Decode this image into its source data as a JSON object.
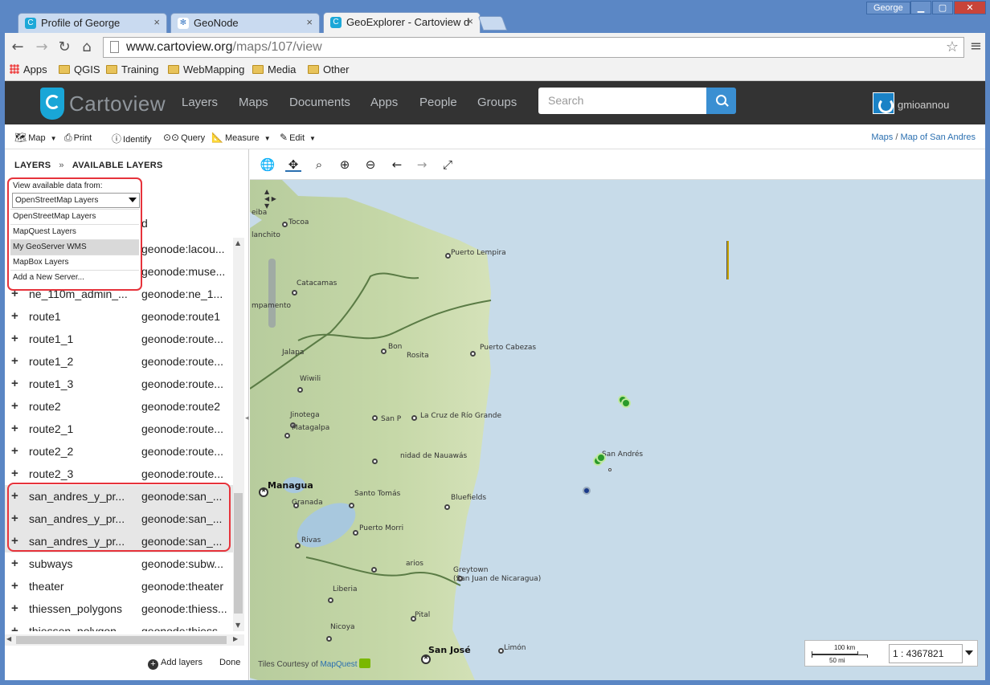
{
  "browser": {
    "tabs": [
      {
        "label": "Profile of George",
        "favicon": "cartoview-icon"
      },
      {
        "label": "GeoNode",
        "favicon": "geonode-icon"
      },
      {
        "label": "GeoExplorer - Cartoview d",
        "favicon": "cartoview-icon"
      }
    ],
    "user": "George",
    "url_host": "www.cartoview.org",
    "url_path": "/maps/107/view",
    "bookmarks": [
      "Apps",
      "QGIS",
      "Training",
      "WebMapping",
      "Media",
      "Other"
    ]
  },
  "navbar": {
    "brand": "Cartoview",
    "links": [
      "Layers",
      "Maps",
      "Documents",
      "Apps",
      "People",
      "Groups"
    ],
    "search_placeholder": "Search",
    "username": "gmioannou"
  },
  "toolbar": {
    "items": [
      "Map",
      "Print",
      "Identify",
      "Query",
      "Measure",
      "Edit"
    ],
    "breadcrumb": {
      "link1": "Maps",
      "sep": "/",
      "link2": "Map of San Andres"
    }
  },
  "panel": {
    "tab_layers": "LAYERS",
    "tab_sep": "»",
    "tab_available": "AVAILABLE LAYERS",
    "server_label": "View available data from:",
    "server_selected": "OpenStreetMap Layers",
    "server_options": [
      "OpenStreetMap Layers",
      "MapQuest Layers",
      "My GeoServer WMS",
      "MapBox Layers",
      "Add a New Server..."
    ],
    "header_fragment": "d",
    "layers": [
      {
        "name": "",
        "title": "geonode:lacou..."
      },
      {
        "name": "",
        "title": "geonode:muse..."
      },
      {
        "name": "ne_110m_admin_...",
        "title": "geonode:ne_1..."
      },
      {
        "name": "route1",
        "title": "geonode:route1"
      },
      {
        "name": "route1_1",
        "title": "geonode:route..."
      },
      {
        "name": "route1_2",
        "title": "geonode:route..."
      },
      {
        "name": "route1_3",
        "title": "geonode:route..."
      },
      {
        "name": "route2",
        "title": "geonode:route2"
      },
      {
        "name": "route2_1",
        "title": "geonode:route..."
      },
      {
        "name": "route2_2",
        "title": "geonode:route..."
      },
      {
        "name": "route2_3",
        "title": "geonode:route..."
      },
      {
        "name": "san_andres_y_pr...",
        "title": "geonode:san_..."
      },
      {
        "name": "san_andres_y_pr...",
        "title": "geonode:san_..."
      },
      {
        "name": "san_andres_y_pr...",
        "title": "geonode:san_..."
      },
      {
        "name": "subways",
        "title": "geonode:subw..."
      },
      {
        "name": "theater",
        "title": "geonode:theater"
      },
      {
        "name": "thiessen_polygons",
        "title": "geonode:thiess..."
      },
      {
        "name": "thiessen_polygon...",
        "title": "geonode:thiess..."
      }
    ],
    "add_layers": "Add layers",
    "done": "Done"
  },
  "map": {
    "places": [
      "Tocoa",
      "Puerto Lempira",
      "Catacamas",
      "Bon",
      "Rosita",
      "Puerto Cabezas",
      "Wiwili",
      "Jinotega",
      "San P",
      "La Cruz de Río Grande",
      "Matagalpa",
      "nidad de Nauawás",
      "San Andrés",
      "Managua",
      "Santo Tomás",
      "Bluefields",
      "Granada",
      "Puerto Morri",
      "Rivas",
      "Greytown",
      "(San Juan de Nicaragua)",
      "Liberia",
      "Pital",
      "Nicoya",
      "San José",
      "Limón",
      "eiba",
      "lanchito",
      "mpamento",
      "Jalapa",
      "arios"
    ],
    "attribution": "Tiles Courtesy of",
    "attribution_link": "MapQuest",
    "scale_km": "100 km",
    "scale_mi": "50 mi",
    "scale_value": "1 : 4367821"
  }
}
